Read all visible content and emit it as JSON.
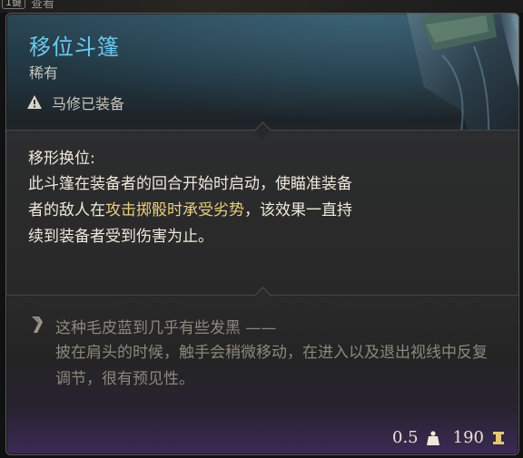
{
  "top_hint": {
    "key": "1键",
    "label": "查看"
  },
  "item": {
    "name": "移位斗篷",
    "rarity": "稀有",
    "equipped_text": "马修已装备",
    "name_color": "#6cc9ee"
  },
  "ability": {
    "title": "移形换位:",
    "body_part1": "此斗篷在装备者的回合开始时启动，使瞄准装备者的敌人在",
    "highlight": "攻击掷骰时承受劣势",
    "body_part2": "，该效果一直持续到装备者受到伤害为止。",
    "highlight_color": "#e9cf7e"
  },
  "flavor": {
    "line1": "这种毛皮蓝到几乎有些发黑 ——",
    "body": "披在肩头的时候，触手会稍微移动，在进入以及退出视线中反复调节，很有预见性。"
  },
  "footer": {
    "weight": "0.5",
    "weight_icon": "weight-icon",
    "value": "190",
    "value_icon": "gold-icon"
  }
}
